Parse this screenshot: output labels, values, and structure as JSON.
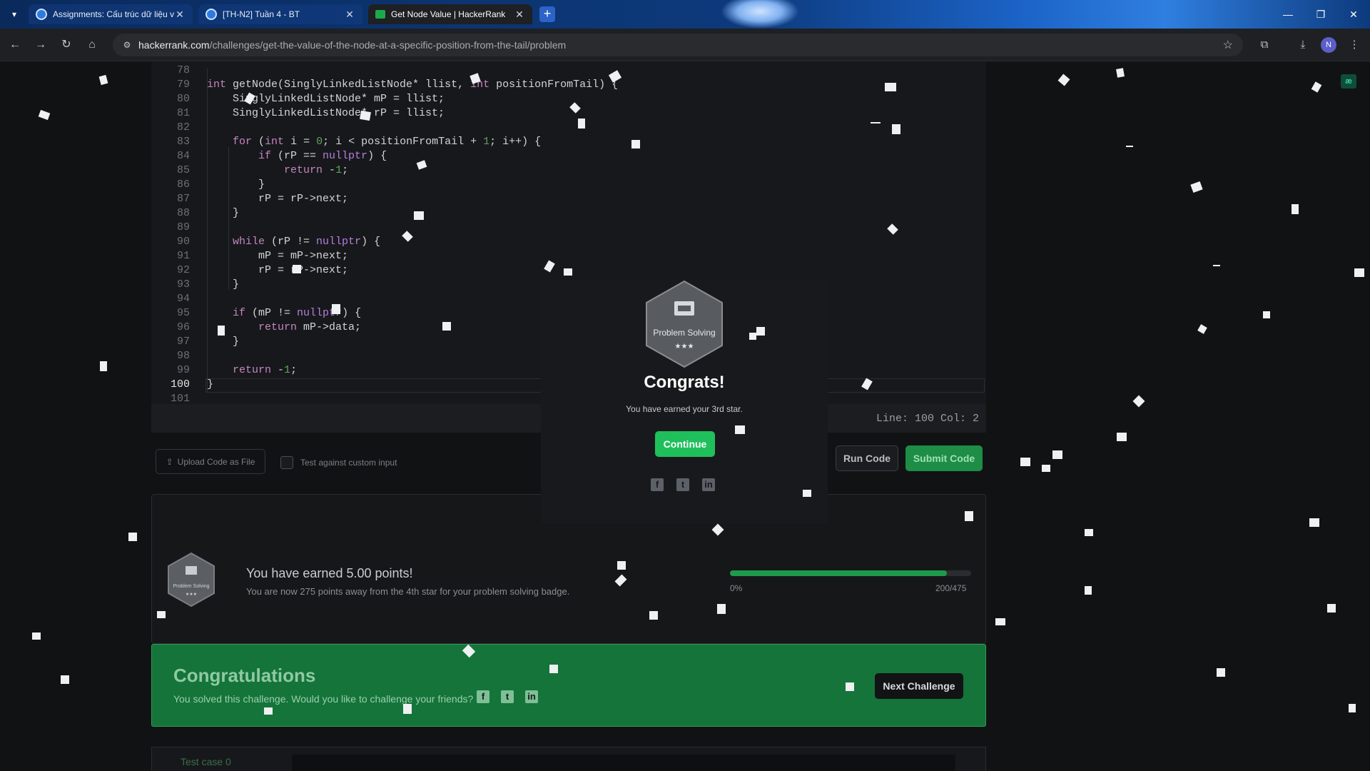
{
  "browser": {
    "tabs": [
      {
        "title": "Assignments: Cấu trúc dữ liệu v",
        "active": false
      },
      {
        "title": "[TH-N2] Tuần 4 - BT",
        "active": false
      },
      {
        "title": "Get Node Value | HackerRank",
        "active": true
      }
    ],
    "new_tab": "+",
    "url_domain": "hackerrank.com",
    "url_path": "/challenges/get-the-value-of-the-node-at-a-specific-position-from-the-tail/problem",
    "profile_initial": "N",
    "extension_label": "æ"
  },
  "editor": {
    "line_numbers": [
      "78",
      "79",
      "80",
      "81",
      "82",
      "83",
      "84",
      "85",
      "86",
      "87",
      "88",
      "89",
      "90",
      "91",
      "92",
      "93",
      "94",
      "95",
      "96",
      "97",
      "98",
      "99",
      "100",
      "101"
    ],
    "current_line": "100",
    "status": "Line: 100 Col: 2"
  },
  "actions": {
    "upload_label": "Upload Code as File",
    "custom_input_label": "Test against custom input",
    "run_label": "Run Code",
    "submit_label": "Submit Code"
  },
  "points": {
    "badge_name": "Problem Solving",
    "title": "You have earned 5.00 points!",
    "subtitle": "You are now 275 points away from the 4th star for your problem solving badge.",
    "progress_min_label": "0%",
    "progress_max_label": "200/475",
    "progress_fraction": 0.9
  },
  "banner": {
    "title": "Congratulations",
    "subtitle": "You solved this challenge. Would you like to challenge your friends?",
    "next_label": "Next Challenge"
  },
  "testcase": {
    "label": "Test case 0"
  },
  "modal": {
    "badge_name": "Problem Solving",
    "stars": "★★★",
    "title": "Congrats!",
    "subtitle": "You have earned your 3rd star.",
    "continue_label": "Continue"
  },
  "colors": {
    "accent_green": "#1fbf5c",
    "banner_green": "#14743a"
  }
}
